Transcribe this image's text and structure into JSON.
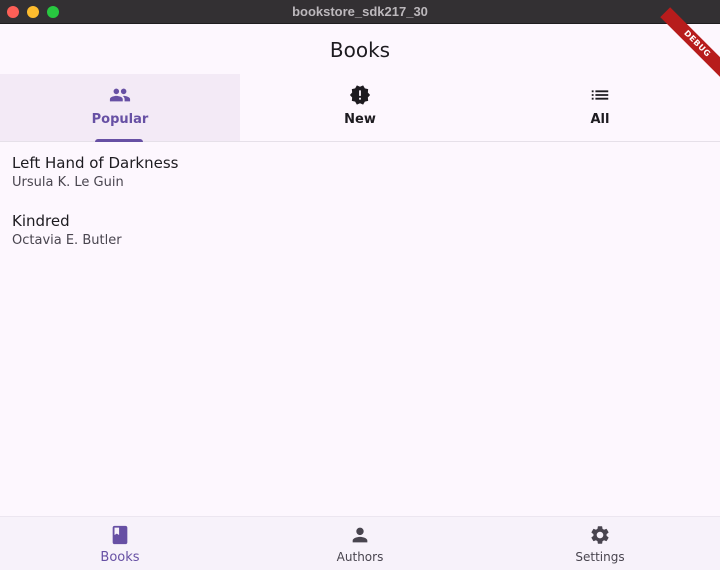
{
  "window": {
    "title": "bookstore_sdk217_30"
  },
  "appbar": {
    "title": "Books",
    "debug_banner": "DEBUG"
  },
  "tabs": [
    {
      "label": "Popular",
      "icon": "people-icon",
      "active": true
    },
    {
      "label": "New",
      "icon": "new-releases-icon",
      "active": false
    },
    {
      "label": "All",
      "icon": "list-icon",
      "active": false
    }
  ],
  "books": [
    {
      "title": "Left Hand of Darkness",
      "author": "Ursula K. Le Guin"
    },
    {
      "title": "Kindred",
      "author": "Octavia E. Butler"
    }
  ],
  "nav": [
    {
      "label": "Books",
      "icon": "book-icon",
      "active": true
    },
    {
      "label": "Authors",
      "icon": "person-icon",
      "active": false
    },
    {
      "label": "Settings",
      "icon": "settings-icon",
      "active": false
    }
  ],
  "colors": {
    "primary": "#6750a4",
    "icon_dark": "#49454f",
    "surface": "#fdf7fe",
    "active_tab_bg": "#f3eaf6"
  }
}
